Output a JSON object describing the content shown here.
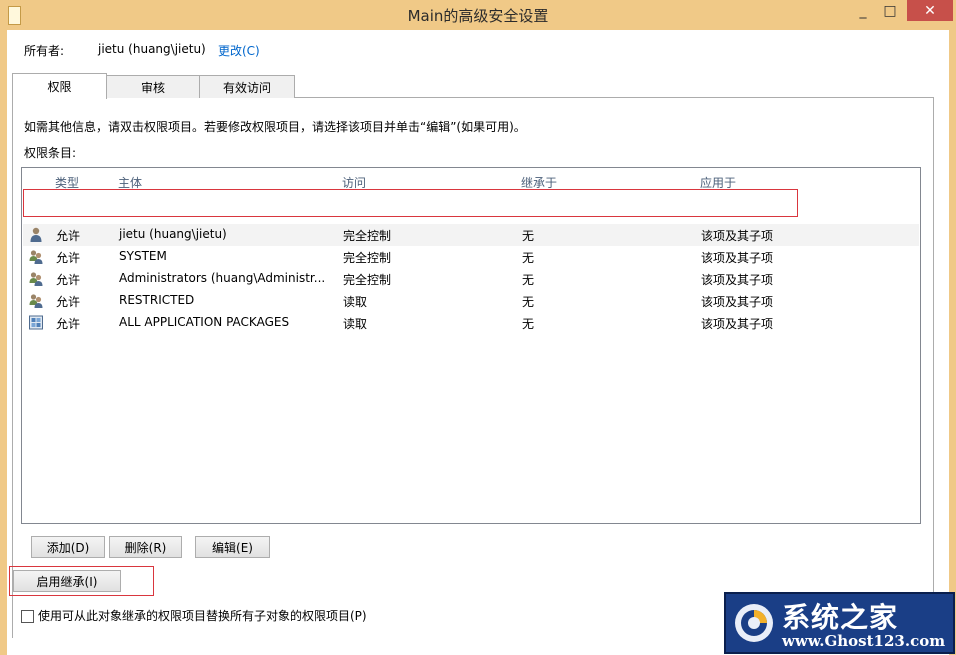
{
  "window": {
    "title": "Main的高级安全设置",
    "min_glyph": "_",
    "max_glyph": "□",
    "close_glyph": "✕",
    "icon": "folder-icon"
  },
  "owner": {
    "label": "所有者:",
    "value": "jietu (huang\\jietu)",
    "change_link": "更改(C)"
  },
  "tabs": [
    {
      "label": "权限",
      "active": true
    },
    {
      "label": "审核",
      "active": false
    },
    {
      "label": "有效访问",
      "active": false
    }
  ],
  "info_text": "如需其他信息，请双击权限项目。若要修改权限项目，请选择该项目并单击“编辑”(如果可用)。",
  "entries_label": "权限条目:",
  "list": {
    "columns": [
      "类型",
      "主体",
      "访问",
      "继承于",
      "应用于"
    ],
    "rows": [
      {
        "icon": "user-icon",
        "type": "允许",
        "principal": "jietu (huang\\jietu)",
        "access": "完全控制",
        "inherited": "无",
        "applies": "该项及其子项",
        "selected": true
      },
      {
        "icon": "group-icon",
        "type": "允许",
        "principal": "SYSTEM",
        "access": "完全控制",
        "inherited": "无",
        "applies": "该项及其子项",
        "selected": false
      },
      {
        "icon": "group-icon",
        "type": "允许",
        "principal": "Administrators (huang\\Administr...",
        "access": "完全控制",
        "inherited": "无",
        "applies": "该项及其子项",
        "selected": false
      },
      {
        "icon": "group-icon",
        "type": "允许",
        "principal": "RESTRICTED",
        "access": "读取",
        "inherited": "无",
        "applies": "该项及其子项",
        "selected": false
      },
      {
        "icon": "app-packages-icon",
        "type": "允许",
        "principal": "ALL APPLICATION PACKAGES",
        "access": "读取",
        "inherited": "无",
        "applies": "该项及其子项",
        "selected": false
      }
    ]
  },
  "buttons": {
    "add": "添加(D)",
    "remove": "删除(R)",
    "edit": "编辑(E)",
    "enable_inheritance": "启用继承(I)"
  },
  "replace_checkbox": {
    "label": "使用可从此对象继承的权限项目替换所有子对象的权限项目(P)",
    "checked": false
  },
  "watermark": {
    "title": "系统之家",
    "url": "www.Ghost123.com"
  },
  "colors": {
    "titlebar": "#f0c987",
    "close_button": "#c7504a",
    "highlight": "#d9363e",
    "link": "#0066cc"
  }
}
